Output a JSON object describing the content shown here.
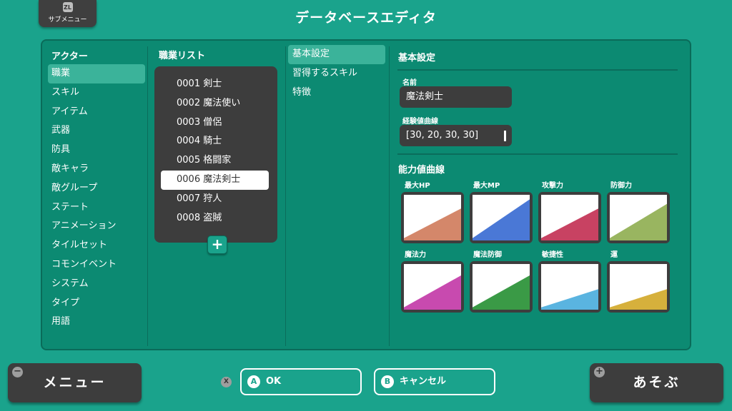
{
  "header": {
    "submenu_key": "ZL",
    "submenu_label": "サブメニュー",
    "title": "データベースエディタ"
  },
  "categories": {
    "heading": "アクター",
    "items": [
      "職業",
      "スキル",
      "アイテム",
      "武器",
      "防具",
      "敵キャラ",
      "敵グループ",
      "ステート",
      "アニメーション",
      "タイルセット",
      "コモンイベント",
      "システム",
      "タイプ",
      "用語"
    ],
    "selected_index": 0
  },
  "jobs": {
    "heading": "職業リスト",
    "items": [
      "0001 剣士",
      "0002 魔法使い",
      "0003 僧侶",
      "0004 騎士",
      "0005 格闘家",
      "0006 魔法剣士",
      "0007 狩人",
      "0008 盗賊"
    ],
    "selected_index": 5,
    "add_label": "+"
  },
  "tabs": {
    "items": [
      "基本設定",
      "習得するスキル",
      "特徴"
    ],
    "selected_index": 0
  },
  "detail": {
    "heading": "基本設定",
    "name_label": "名前",
    "name_value": "魔法剣士",
    "exp_label": "経験値曲線",
    "exp_value": "[30, 20, 30, 30]",
    "params_heading": "能力値曲線",
    "params": [
      {
        "label": "最大HP",
        "color": "#d4876a",
        "start": 0.95,
        "end": 0.3
      },
      {
        "label": "最大MP",
        "color": "#4a78d6",
        "start": 0.95,
        "end": 0.1
      },
      {
        "label": "攻撃力",
        "color": "#c84262",
        "start": 0.95,
        "end": 0.3
      },
      {
        "label": "防御力",
        "color": "#99b560",
        "start": 0.95,
        "end": 0.2
      },
      {
        "label": "魔法力",
        "color": "#c84aaf",
        "start": 0.95,
        "end": 0.25
      },
      {
        "label": "魔法防御",
        "color": "#3a9a46",
        "start": 0.95,
        "end": 0.25
      },
      {
        "label": "敏捷性",
        "color": "#5ab4e0",
        "start": 0.95,
        "end": 0.55
      },
      {
        "label": "運",
        "color": "#d6b03c",
        "start": 0.95,
        "end": 0.55
      }
    ]
  },
  "footer": {
    "menu_icon": "−",
    "menu_label": "メニュー",
    "x_icon": "X",
    "ok_key": "A",
    "ok_label": "OK",
    "cancel_key": "B",
    "cancel_label": "キャンセル",
    "play_icon": "+",
    "play_label": "あそぶ"
  }
}
